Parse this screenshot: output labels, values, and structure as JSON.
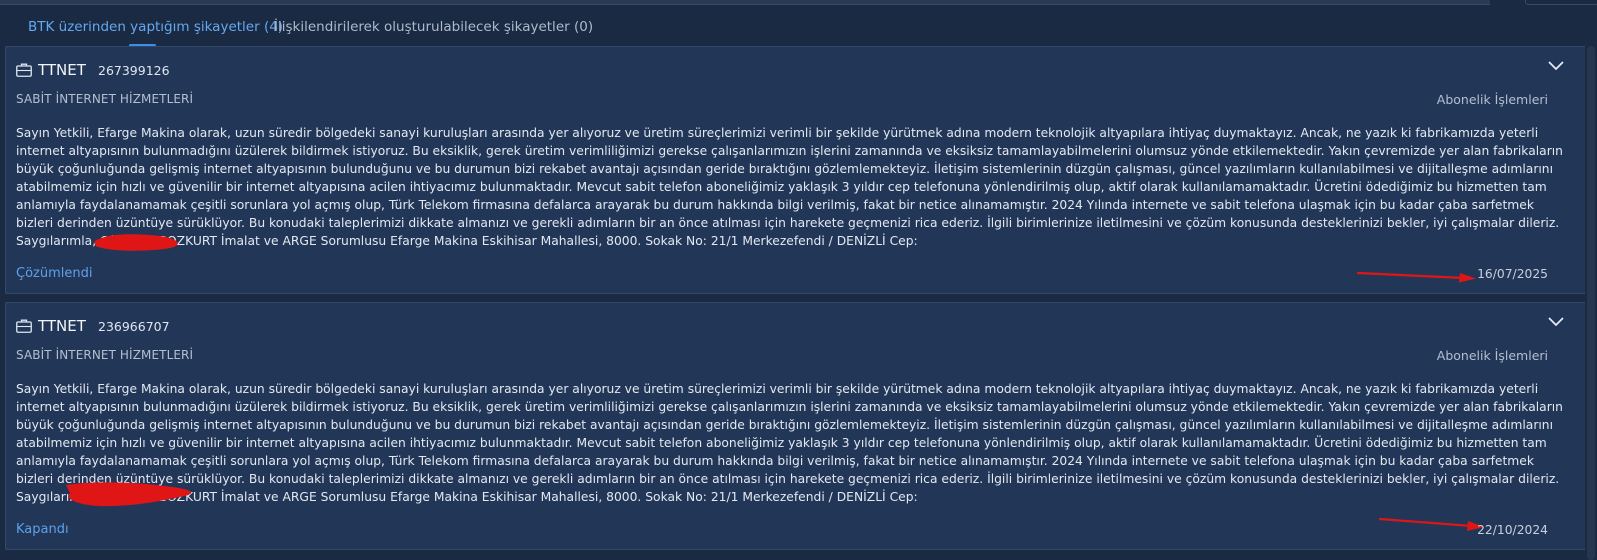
{
  "tabs": [
    {
      "label": "BTK üzerinden yaptığım şikayetler (4)",
      "active": true
    },
    {
      "label": "İlişkilendirilerek oluşturulabilecek şikayetler (0)",
      "active": false
    }
  ],
  "complaints": [
    {
      "vendor": "TTNET",
      "number": "267399126",
      "category": "SABİT İNTERNET HİZMETLERİ",
      "subcategory": "Abonelik İşlemleri",
      "text": "Sayın Yetkili, Efarge Makina olarak, uzun süredir bölgedeki sanayi kuruluşları arasında yer alıyoruz ve üretim süreçlerimizi verimli bir şekilde yürütmek adına modern teknolojik altyapılara ihtiyaç duymaktayız. Ancak, ne yazık ki fabrikamızda yeterli internet altyapısının bulunmadığını üzülerek bildirmek istiyoruz. Bu eksiklik, gerek üretim verimliliğimizi gerekse çalışanlarımızın işlerini zamanında ve eksiksiz tamamlayabilmelerini olumsuz yönde etkilemektedir. Yakın çevremizde yer alan fabrikaların büyük çoğunluğunda gelişmiş internet altyapısının bulunduğunu ve bu durumun bizi rekabet avantajı açısından geride bıraktığını gözlemlemekteyiz. İletişim sistemlerinin düzgün çalışması, güncel yazılımların kullanılabilmesi ve dijitalleşme adımlarını atabilmemiz için hızlı ve güvenilir bir internet altyapısına acilen ihtiyacımız bulunmaktadır. Mevcut sabit telefon aboneliğimiz yaklaşık 3 yıldır cep telefonuna yönlendirilmiş olup, aktif olarak kullanılamamaktadır. Ücretini ödediğimiz bu hizmetten tam anlamıyla faydalanamamak çeşitli sorunlara yol açmış olup, Türk Telekom firmasına defalarca arayarak bu durum hakkında bilgi verilmiş, fakat bir netice alınamamıştır. 2024 Yılında internete ve sabit telefona ulaşmak için bu kadar çaba sarfetmek bizleri derinden üzüntüye sürüklüyor. Bu konudaki taleplerimizi dikkate almanızı ve gerekli adımların bir an önce atılması için harekete geçmenizi rica ederiz. İlgili birimlerinize iletilmesini ve çözüm konusunda desteklerinizi bekler, iyi çalışmalar dileriz. Saygılarımla, Oğuzhan BOZKURT İmalat ve ARGE Sorumlusu Efarge Makina Eskihisar Mahallesi, 8000. Sokak No: 21/1 Merkezefendi / DENİZLİ Cep:",
      "status": "Çözümlendi",
      "date": "16/07/2025"
    },
    {
      "vendor": "TTNET",
      "number": "236966707",
      "category": "SABİT İNTERNET HİZMETLERİ",
      "subcategory": "Abonelik İşlemleri",
      "text": "Sayın Yetkili, Efarge Makina olarak, uzun süredir bölgedeki sanayi kuruluşları arasında yer alıyoruz ve üretim süreçlerimizi verimli bir şekilde yürütmek adına modern teknolojik altyapılara ihtiyaç duymaktayız. Ancak, ne yazık ki fabrikamızda yeterli internet altyapısının bulunmadığını üzülerek bildirmek istiyoruz. Bu eksiklik, gerek üretim verimliliğimizi gerekse çalışanlarımızın işlerini zamanında ve eksiksiz tamamlayabilmelerini olumsuz yönde etkilemektedir. Yakın çevremizde yer alan fabrikaların büyük çoğunluğunda gelişmiş internet altyapısının bulunduğunu ve bu durumun bizi rekabet avantajı açısından geride bıraktığını gözlemlemekteyiz. İletişim sistemlerinin düzgün çalışması, güncel yazılımların kullanılabilmesi ve dijitalleşme adımlarını atabilmemiz için hızlı ve güvenilir bir internet altyapısına acilen ihtiyacımız bulunmaktadır. Mevcut sabit telefon aboneliğimiz yaklaşık 3 yıldır cep telefonuna yönlendirilmiş olup, aktif olarak kullanılamamaktadır. Ücretini ödediğimiz bu hizmetten tam anlamıyla faydalanamamak çeşitli sorunlara yol açmış olup, Türk Telekom firmasına defalarca arayarak bu durum hakkında bilgi verilmiş, fakat bir netice alınamamıştır. 2024 Yılında internete ve sabit telefona ulaşmak için bu kadar çaba sarfetmek bizleri derinden üzüntüye sürüklüyor. Bu konudaki taleplerimizi dikkate almanızı ve gerekli adımların bir an önce atılması için harekete geçmenizi rica ederiz. İlgili birimlerinize iletilmesini ve çözüm konusunda desteklerinizi bekler, iyi çalışmalar dileriz. Saygılarımla, Oğuzhan BOZKURT İmalat ve ARGE Sorumlusu Efarge Makina Eskihisar Mahallesi, 8000. Sokak No: 21/1 Merkezefendi / DENİZLİ Cep:",
      "status": "Kapandı",
      "date": "22/10/2024"
    }
  ],
  "icons": {
    "vendor": "briefcase-icon",
    "expand": "chevron-down-icon"
  },
  "colors": {
    "background": "#1b2a43",
    "card": "#223758",
    "accent": "#5fa0ea",
    "annotation": "#e01616"
  }
}
